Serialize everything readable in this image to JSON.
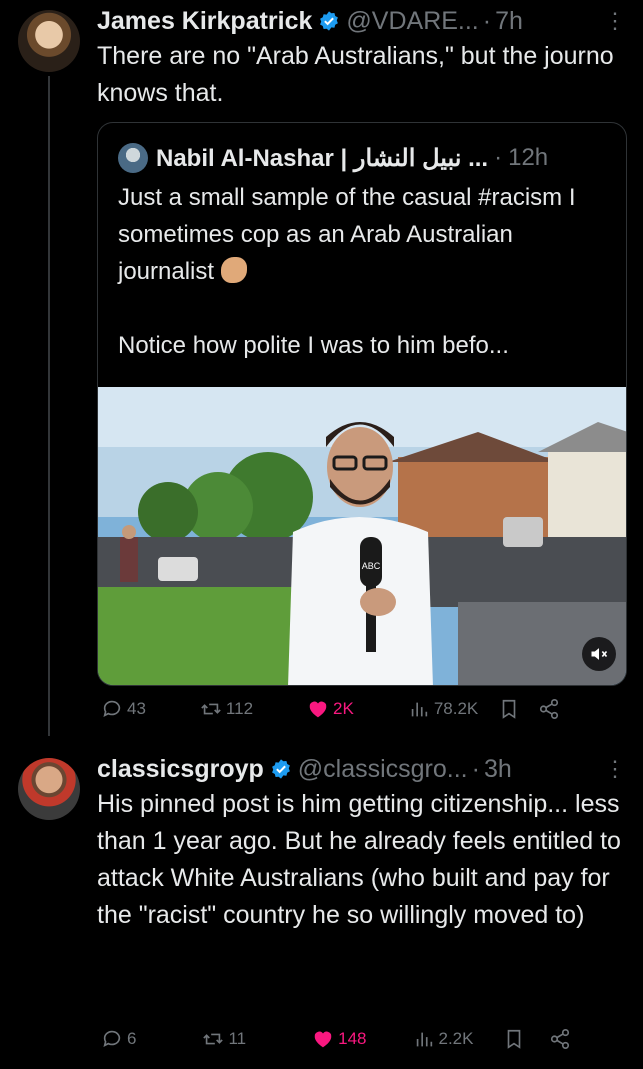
{
  "tweet1": {
    "name": "James Kirkpatrick",
    "handle": "@VDARE...",
    "dot": "·",
    "time": "7h",
    "text": "There are no \"Arab Australians,\" but the journo knows that.",
    "quote": {
      "name": "Nabil Al-Nashar | نبيل النشار ...",
      "dot": "·",
      "time": "12h",
      "text_line1": "Just a small sample of the casual #racism I sometimes cop as an Arab Australian journalist",
      "emoji": "pinching-hand-emoji",
      "text_line2": "Notice how polite I was to him befo...",
      "media_label": "ABC"
    },
    "actions": {
      "replies": "43",
      "reposts": "112",
      "likes": "2K",
      "views": "78.2K"
    }
  },
  "tweet2": {
    "name": "classicsgroyp",
    "handle": "@classicsgro...",
    "dot": "·",
    "time": "3h",
    "text": "His pinned post is him getting citizenship... less than 1 year ago. But he already feels entitled to attack White Australians (who built and pay for the \"racist\" country he so willingly moved to)",
    "actions": {
      "replies": "6",
      "reposts": "11",
      "likes": "148",
      "views": "2.2K"
    }
  },
  "colors": {
    "background": "#000000",
    "text": "#e7e9ea",
    "muted": "#71767b",
    "verified": "#1d9bf0",
    "like": "#f91880",
    "border": "#2f3336"
  }
}
